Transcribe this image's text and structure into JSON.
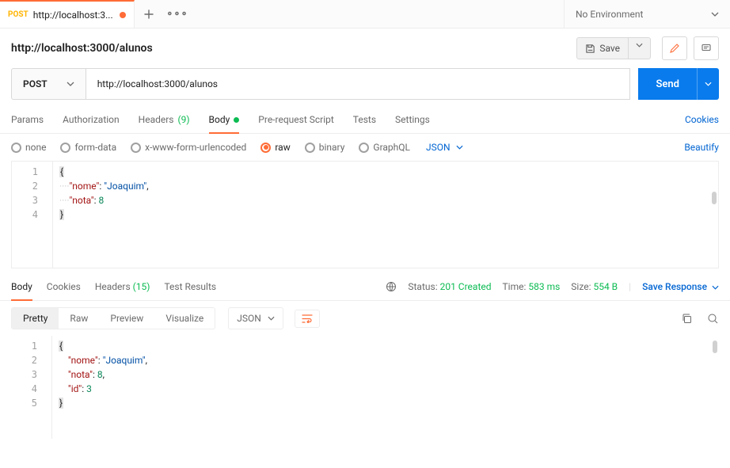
{
  "colors": {
    "accent": "#ff6c37",
    "primary": "#097bed",
    "success": "#0cbb52",
    "link": "#0265d2"
  },
  "tab": {
    "method": "POST",
    "title": "http://localhost:3...",
    "unsaved": true
  },
  "env": {
    "label": "No Environment"
  },
  "request": {
    "name": "http://localhost:3000/alunos",
    "save_label": "Save",
    "method": "POST",
    "url": "http://localhost:3000/alunos",
    "send_label": "Send"
  },
  "req_tabs": {
    "params": "Params",
    "auth": "Authorization",
    "headers": "Headers",
    "headers_count": "(9)",
    "body": "Body",
    "prereq": "Pre-request Script",
    "tests": "Tests",
    "settings": "Settings",
    "cookies": "Cookies"
  },
  "body_types": {
    "none": "none",
    "form": "form-data",
    "xwww": "x-www-form-urlencoded",
    "raw": "raw",
    "binary": "binary",
    "graphql": "GraphQL",
    "json": "JSON",
    "beautify": "Beautify"
  },
  "req_body": {
    "lines": [
      "1",
      "2",
      "3",
      "4"
    ],
    "content": [
      {
        "type": "brace",
        "text": "{"
      },
      {
        "type": "kv",
        "indent": 4,
        "key": "\"nome\"",
        "sep": ": ",
        "val": "\"Joaquim\"",
        "valClass": "str",
        "tail": ","
      },
      {
        "type": "kv",
        "indent": 4,
        "key": "\"nota\"",
        "sep": ": ",
        "val": "8",
        "valClass": "num",
        "tail": ""
      },
      {
        "type": "brace",
        "text": "}"
      }
    ]
  },
  "resp_tabs": {
    "body": "Body",
    "cookies": "Cookies",
    "headers": "Headers",
    "headers_count": "(15)",
    "tests": "Test Results"
  },
  "resp_meta": {
    "status_label": "Status:",
    "status_value": "201 Created",
    "time_label": "Time:",
    "time_value": "583 ms",
    "size_label": "Size:",
    "size_value": "554 B",
    "save_resp": "Save Response"
  },
  "views": {
    "pretty": "Pretty",
    "raw": "Raw",
    "preview": "Preview",
    "visualize": "Visualize",
    "json": "JSON"
  },
  "resp_body": {
    "lines": [
      "1",
      "2",
      "3",
      "4",
      "5"
    ],
    "content": [
      {
        "type": "brace",
        "text": "{"
      },
      {
        "type": "kv",
        "indent": 4,
        "key": "\"nome\"",
        "sep": ": ",
        "val": "\"Joaquim\"",
        "valClass": "str",
        "tail": ","
      },
      {
        "type": "kv",
        "indent": 4,
        "key": "\"nota\"",
        "sep": ": ",
        "val": "8",
        "valClass": "num",
        "tail": ","
      },
      {
        "type": "kv",
        "indent": 4,
        "key": "\"id\"",
        "sep": ": ",
        "val": "3",
        "valClass": "num",
        "tail": ""
      },
      {
        "type": "brace",
        "text": "}"
      }
    ]
  }
}
